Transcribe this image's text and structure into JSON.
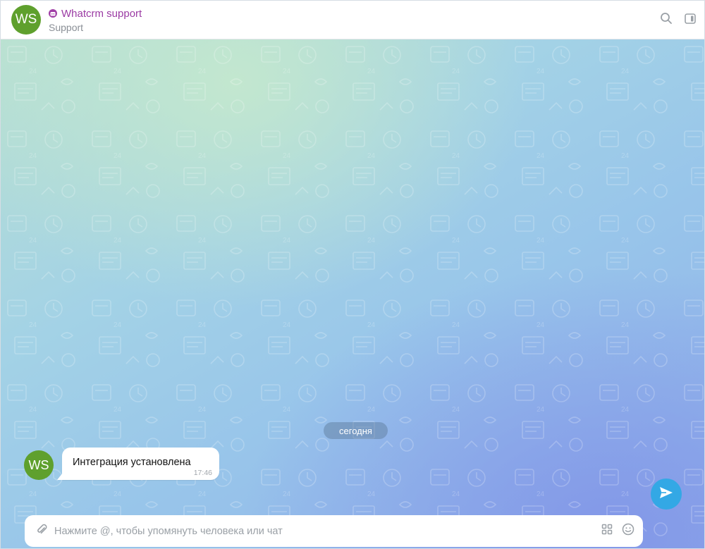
{
  "header": {
    "avatar_initials": "WS",
    "title": "Whatcrm support",
    "subtitle": "Support",
    "bot_icon": "bot-icon",
    "actions": [
      "search-icon",
      "sidebar-panel-icon"
    ]
  },
  "chat": {
    "date_separator": "сегодня",
    "messages": [
      {
        "avatar_initials": "WS",
        "text": "Интеграция установлена",
        "time": "17:46"
      }
    ]
  },
  "composer": {
    "placeholder": "Нажмите @, чтобы упомянуть человека или чат",
    "value": "",
    "icons": [
      "paperclip-icon",
      "commands-grid-icon",
      "emoji-icon",
      "send-icon"
    ]
  },
  "colors": {
    "avatar": "#5fa02d",
    "title": "#9b3ba4",
    "send_button": "#33a8e5"
  }
}
